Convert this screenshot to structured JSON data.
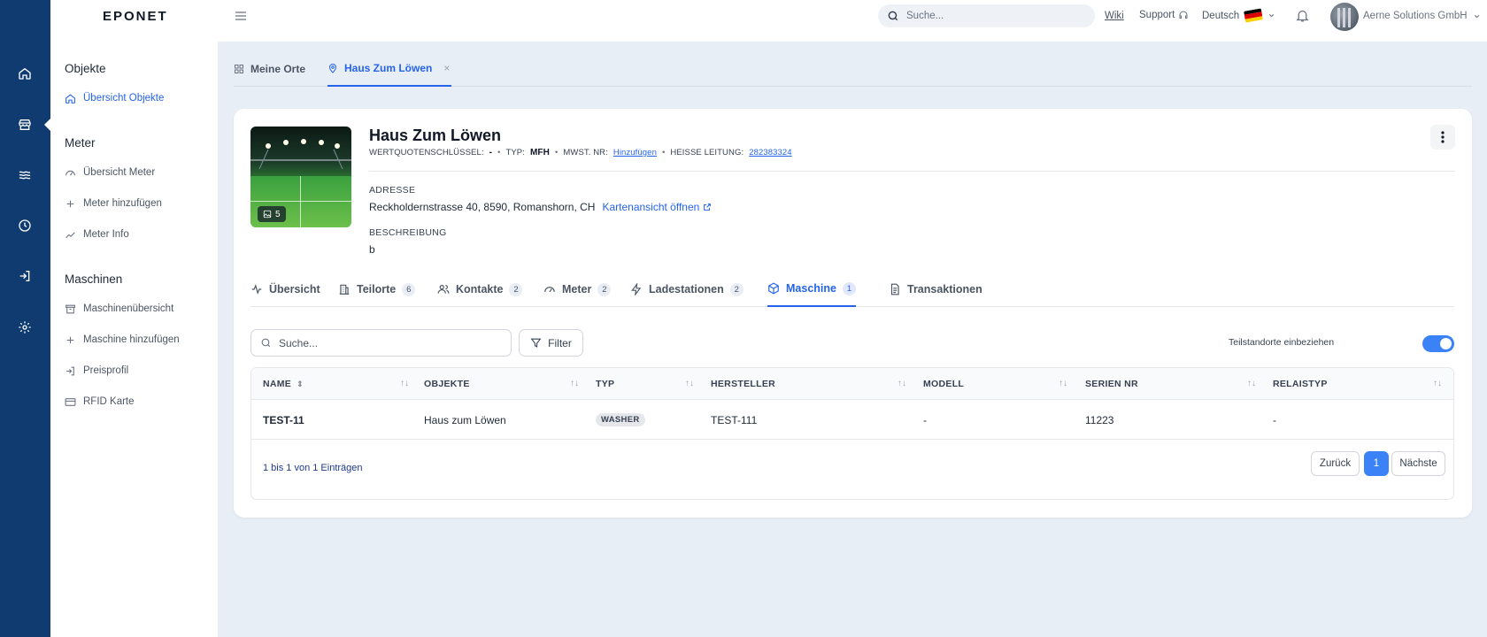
{
  "brand": {
    "logo": "EPONET"
  },
  "sidebar": {
    "sections": [
      {
        "title": "Objekte",
        "items": [
          {
            "label": "Übersicht Objekte",
            "icon": "home-icon",
            "active": true
          }
        ]
      },
      {
        "title": "Meter",
        "items": [
          {
            "label": "Übersicht Meter",
            "icon": "gauge-icon"
          },
          {
            "label": "Meter hinzufügen",
            "icon": "plus-icon"
          },
          {
            "label": "Meter Info",
            "icon": "trend-icon"
          }
        ]
      },
      {
        "title": "Maschinen",
        "items": [
          {
            "label": "Maschinenübersicht",
            "icon": "archive-icon"
          },
          {
            "label": "Maschine hinzufügen",
            "icon": "plus-icon"
          },
          {
            "label": "Preisprofil",
            "icon": "login-icon"
          },
          {
            "label": "RFID Karte",
            "icon": "card-icon"
          }
        ]
      }
    ]
  },
  "topbar": {
    "search_placeholder": "Suche...",
    "wiki": "Wiki",
    "support": "Support",
    "language": "Deutsch",
    "company": "Aerne Solutions GmbH"
  },
  "page_tabs": [
    {
      "label": "Meine Orte",
      "icon": "grid-icon",
      "active": false
    },
    {
      "label": "Haus Zum Löwen",
      "icon": "map-pin-icon",
      "active": true
    }
  ],
  "object": {
    "title": "Haus Zum Löwen",
    "photo_count": "5",
    "meta": {
      "wq_label": "WERTQUOTENSCHLÜSSEL:",
      "wq_value": "-",
      "typ_label": "TYP:",
      "typ_value": "MFH",
      "mwst_label": "MWST. NR:",
      "mwst_value": "Hinzufügen",
      "hl_label": "HEISSE LEITUNG:",
      "hl_value": "282383324"
    },
    "address_label": "ADRESSE",
    "address": "Reckholdernstrasse 40, 8590, Romanshorn, CH",
    "map_link": "Kartenansicht öffnen",
    "description_label": "BESCHREIBUNG",
    "description": "b"
  },
  "subtabs": [
    {
      "label": "Übersicht",
      "icon": "activity-icon",
      "count": ""
    },
    {
      "label": "Teilorte",
      "icon": "building-icon",
      "count": "6"
    },
    {
      "label": "Kontakte",
      "icon": "users-icon",
      "count": "2"
    },
    {
      "label": "Meter",
      "icon": "gauge-icon",
      "count": "2"
    },
    {
      "label": "Ladestationen",
      "icon": "bolt-icon",
      "count": "2"
    },
    {
      "label": "Maschine",
      "icon": "box-icon",
      "count": "1",
      "active": true
    },
    {
      "label": "Transaktionen",
      "icon": "document-icon",
      "count": ""
    }
  ],
  "table": {
    "search_placeholder": "Suche...",
    "filter_label": "Filter",
    "toggle_label": "Teilstandorte einbeziehen",
    "toggle_on": true,
    "columns": [
      "NAME",
      "OBJEKTE",
      "TYP",
      "HERSTELLER",
      "MODELL",
      "SERIEN NR",
      "RELAISTYP"
    ],
    "rows": [
      {
        "name": "TEST-11",
        "objekte": "Haus zum Löwen",
        "typ": "WASHER",
        "hersteller": "TEST-111",
        "modell": "-",
        "serien_nr": "11223",
        "relaistyp": "-"
      }
    ],
    "info": "1 bis 1 von 1 Einträgen",
    "prev": "Zurück",
    "page": "1",
    "next": "Nächste"
  },
  "colors": {
    "accent": "#2563eb",
    "rail": "#0f3b70",
    "toggle": "#3b82f6"
  }
}
